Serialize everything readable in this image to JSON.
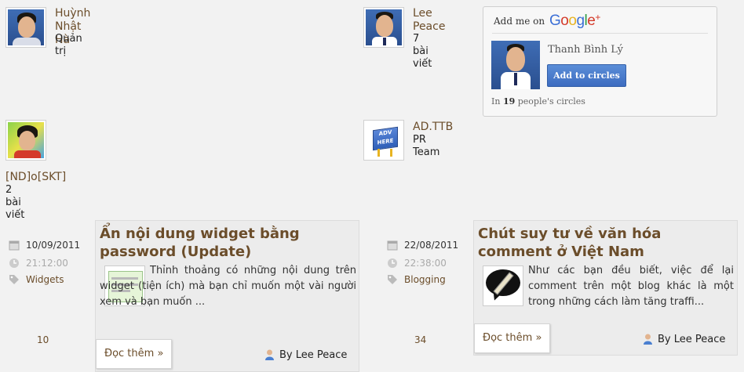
{
  "authors": [
    {
      "name": "Huỳnh Nhật Hà",
      "name_lines": [
        "Huỳnh",
        "Nhật Hà"
      ],
      "role": "Quản trị"
    },
    {
      "name": "Lee Peace",
      "name_lines": [
        "Lee",
        "Peace"
      ],
      "role": "7 bài viết"
    },
    {
      "name": "[ND]o[SKT]",
      "role": "2 bài viết"
    },
    {
      "name": "AD.TTB",
      "role": "PR Team",
      "badge_text": "ADV HERE"
    }
  ],
  "gplus": {
    "title": "Add me on",
    "logo_letters": [
      "G",
      "o",
      "o",
      "g",
      "l",
      "e",
      "+"
    ],
    "logo_colors": [
      "#3b6fd6",
      "#d43a2a",
      "#e8b422",
      "#3b6fd6",
      "#2e9c46",
      "#d43a2a",
      "#d43a2a"
    ],
    "name": "Thanh Bình Lý",
    "button": "Add to circles",
    "circles_prefix": "In",
    "circles_count": "19",
    "circles_suffix": "people's circles"
  },
  "posts": [
    {
      "date": "10/09/2011",
      "time": "21:12:00",
      "category": "Widgets",
      "comment_count": "10",
      "title_lines": [
        "Ẩn nội dung widget bằng",
        "password (Update)"
      ],
      "excerpt": "Thỉnh thoảng có những nội dung trên widget (tiện ích) mà bạn chỉ muốn một vài người xem và bạn muốn ...",
      "read_more": "Đọc thêm »",
      "byline": "By Lee Peace"
    },
    {
      "date": "22/08/2011",
      "time": "22:38:00",
      "category": "Blogging",
      "comment_count": "34",
      "title_lines": [
        "Chút suy tư về văn hóa",
        "comment ở Việt Nam"
      ],
      "excerpt": "Như các bạn đều biết, việc để lại comment trên một blog khác là một trong những cách làm tăng traffi...",
      "read_more": "Đọc thêm »",
      "byline": "By Lee Peace"
    }
  ],
  "colors": {
    "accent": "#6b4d2a",
    "background": "#f2f2f2",
    "button_blue": "#3d6cc0"
  }
}
